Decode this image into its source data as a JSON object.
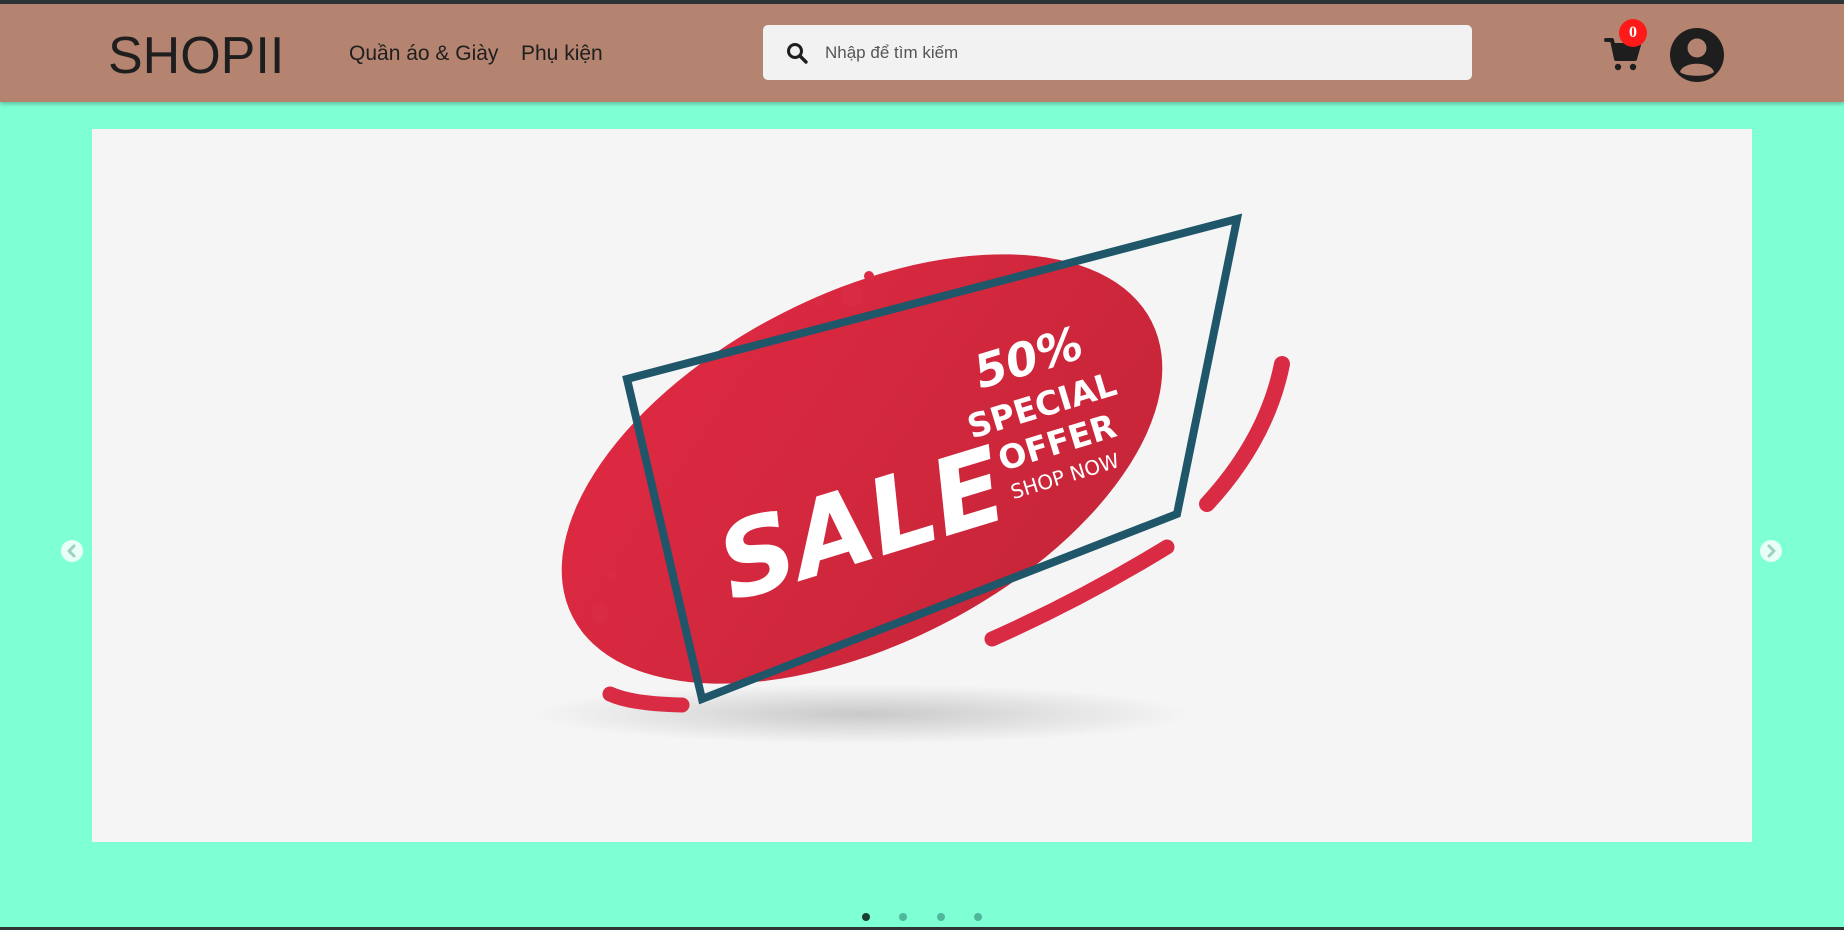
{
  "header": {
    "logo": "SHOPII",
    "nav": [
      {
        "label": "Quần áo & Giày"
      },
      {
        "label": "Phụ kiện"
      }
    ],
    "search": {
      "placeholder": "Nhập để tìm kiếm",
      "value": ""
    },
    "cart": {
      "icon": "cart-icon",
      "count": "0"
    },
    "account": {
      "icon": "user-avatar-icon"
    }
  },
  "carousel": {
    "slide": {
      "banner_text": {
        "sale": "SALE",
        "percent": "50%",
        "special": "SPECIAL",
        "offer": "OFFER",
        "shop_now": "SHOP NOW"
      }
    },
    "prev_icon": "chevron-left-icon",
    "next_icon": "chevron-right-icon",
    "dots_count": 4,
    "active_dot": 1
  },
  "colors": {
    "page_background": "#7fffd4",
    "header_background": "#b48471",
    "banner_red": "#d92c44",
    "frame_teal": "#1f5669",
    "badge_red": "#ff1a1a"
  }
}
